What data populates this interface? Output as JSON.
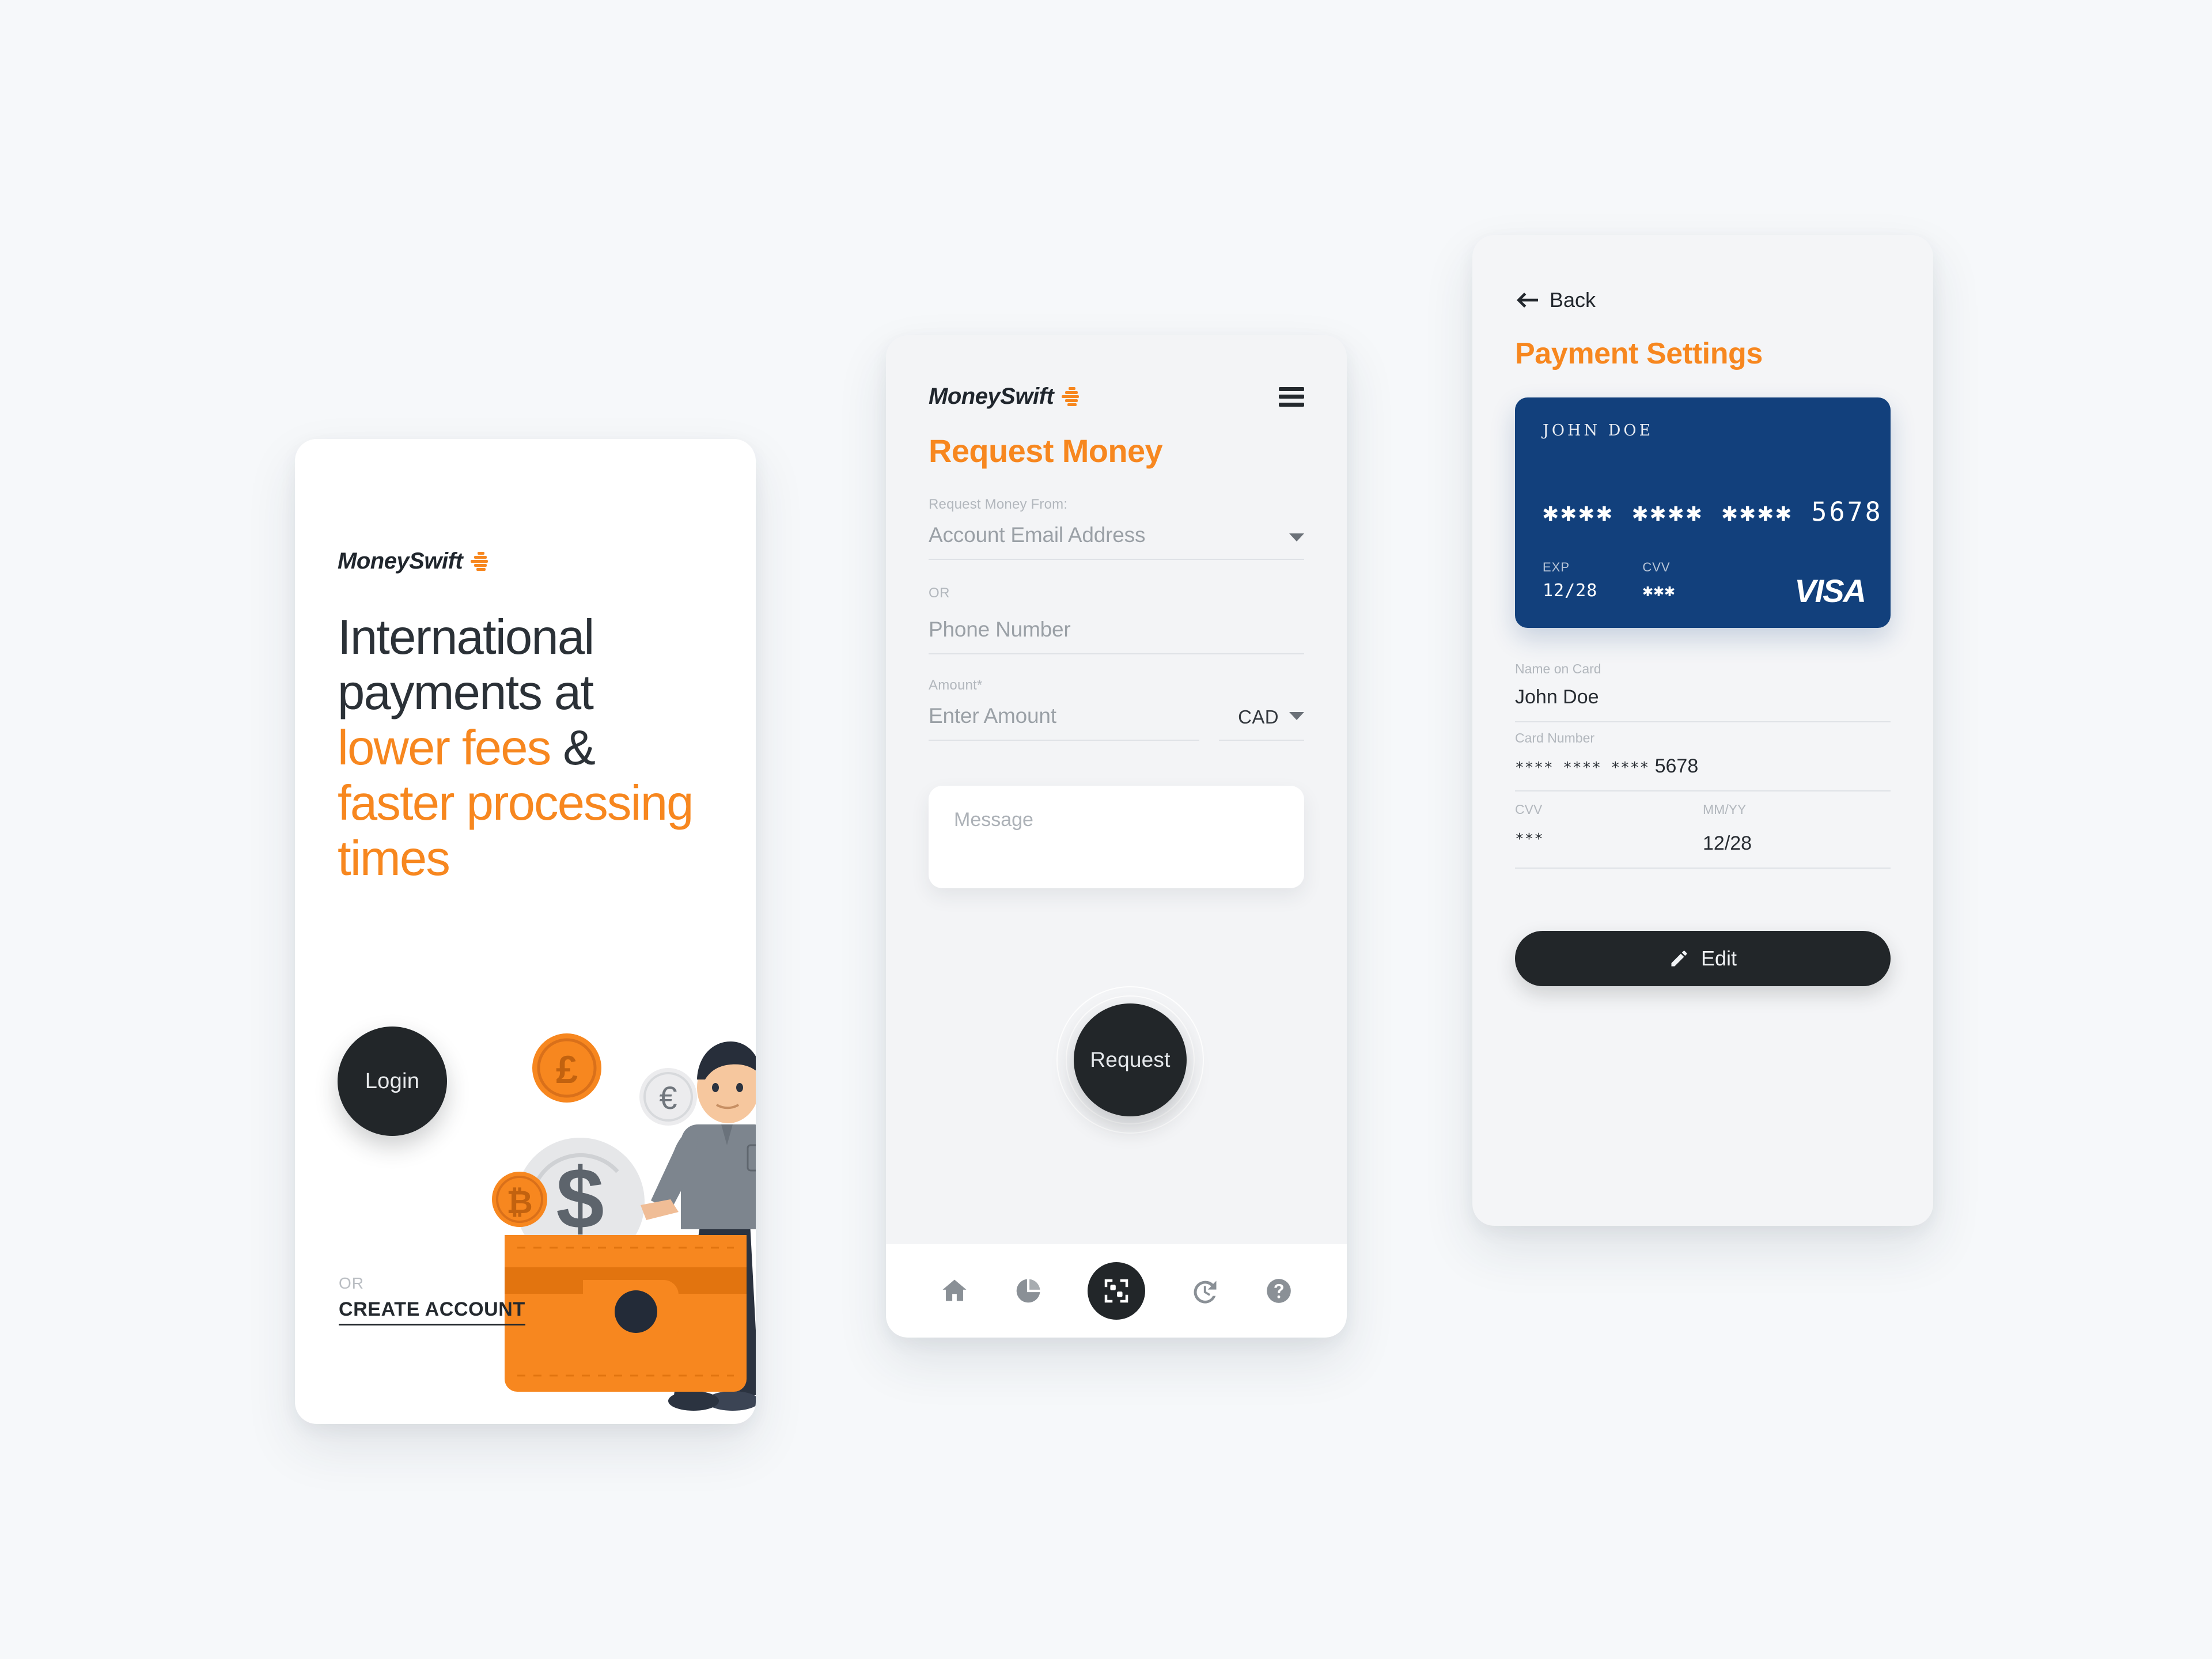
{
  "brand": {
    "name": "MoneySwift",
    "accent_color": "#f7871f",
    "dark_color": "#222629",
    "card_blue": "#12407c",
    "page_background": "#f6f8fa"
  },
  "screen_login": {
    "logo_text": "MoneySwift",
    "headline_line1": "International",
    "headline_line2": "payments at",
    "headline_accent1": "lower fees",
    "headline_amp": "&",
    "headline_accent2": "faster processing",
    "headline_accent3": "times",
    "login_button": "Login",
    "or_label": "OR",
    "create_account": "CREATE ACCOUNT",
    "illustration": {
      "coins": [
        "£",
        "€",
        "₿",
        "$"
      ],
      "wallet_color": "#f7871f"
    }
  },
  "screen_request": {
    "logo_text": "MoneySwift",
    "menu_icon": "hamburger-icon",
    "title": "Request Money",
    "from_label": "Request Money From:",
    "email_value": "Account Email Address",
    "or_label": "OR",
    "phone_value": "Phone Number",
    "amount_label": "Amount*",
    "amount_value": "Enter Amount",
    "currency_value": "CAD",
    "message_placeholder": "Message",
    "request_button": "Request",
    "nav": [
      {
        "icon": "home-icon",
        "active": false
      },
      {
        "icon": "pie-chart-icon",
        "active": false
      },
      {
        "icon": "qr-scan-icon",
        "active": true
      },
      {
        "icon": "history-icon",
        "active": false
      },
      {
        "icon": "help-icon",
        "active": false
      }
    ]
  },
  "screen_payment": {
    "back_label": "Back",
    "title": "Payment Settings",
    "card": {
      "holder": "JOHN  DOE",
      "number": "✱✱✱✱  ✱✱✱✱  ✱✱✱✱  5678",
      "exp_label": "EXP",
      "exp_value": "12/28",
      "cvv_label": "CVV",
      "cvv_value": "✱✱✱",
      "brand": "VISA"
    },
    "fields": [
      {
        "label": "Name on Card",
        "value": "John Doe"
      },
      {
        "label": "Card Number",
        "masked": "**** **** ****",
        "value": "5678"
      },
      {
        "label": "CVV",
        "value": "***"
      },
      {
        "label": "MM/YY",
        "value": "12/28"
      }
    ],
    "edit_button": "Edit"
  }
}
